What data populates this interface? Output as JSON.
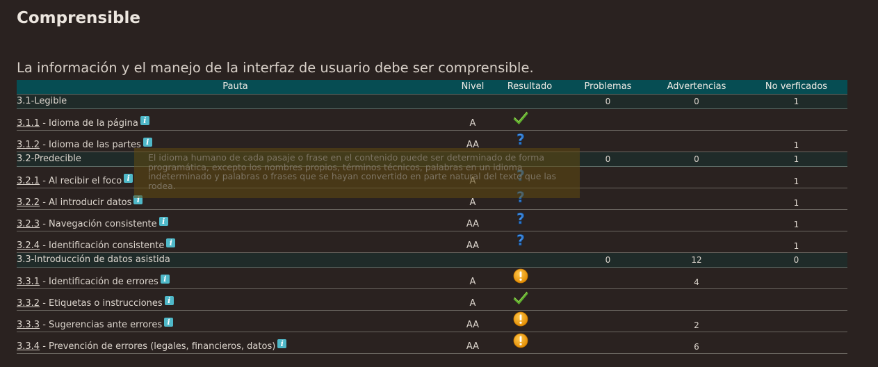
{
  "page": {
    "title": "Comprensible",
    "subtitle": "La información y el manejo de la interfaz de usuario debe ser comprensible."
  },
  "table": {
    "headers": [
      "Pauta",
      "Nivel",
      "Resultado",
      "Problemas",
      "Advertencias",
      "No verficados"
    ],
    "rows": [
      {
        "type": "group",
        "label": "3.1-Legible",
        "problemas": "0",
        "advertencias": "0",
        "no_verificados": "1"
      },
      {
        "type": "item",
        "code": "3.1.1",
        "label": " - Idioma de la página",
        "nivel": "A",
        "resultado": "check-icon",
        "advertencias": "",
        "no_verificados": ""
      },
      {
        "type": "item",
        "code": "3.1.2",
        "label": " - Idioma de las partes",
        "nivel": "AA",
        "resultado": "question-icon",
        "advertencias": "",
        "no_verificados": "1"
      },
      {
        "type": "group",
        "label": "3.2-Predecible",
        "problemas": "0",
        "advertencias": "0",
        "no_verificados": "1"
      },
      {
        "type": "item",
        "code": "3.2.1",
        "label": " - Al recibir el foco",
        "nivel": "A",
        "resultado": "question-icon",
        "advertencias": "",
        "no_verificados": "1"
      },
      {
        "type": "item",
        "code": "3.2.2",
        "label": " - Al introducir datos",
        "nivel": "A",
        "resultado": "question-icon",
        "advertencias": "",
        "no_verificados": "1"
      },
      {
        "type": "item",
        "code": "3.2.3",
        "label": " - Navegación consistente",
        "nivel": "AA",
        "resultado": "question-icon",
        "advertencias": "",
        "no_verificados": "1"
      },
      {
        "type": "item",
        "code": "3.2.4",
        "label": " - Identificación consistente",
        "nivel": "AA",
        "resultado": "question-icon",
        "advertencias": "",
        "no_verificados": "1"
      },
      {
        "type": "group",
        "label": "3.3-Introducción de datos asistida",
        "problemas": "0",
        "advertencias": "12",
        "no_verificados": "0"
      },
      {
        "type": "item",
        "code": "3.3.1",
        "label": " - Identificación de errores",
        "nivel": "A",
        "resultado": "warning-icon",
        "advertencias": "4",
        "no_verificados": ""
      },
      {
        "type": "item",
        "code": "3.3.2",
        "label": " - Etiquetas o instrucciones",
        "nivel": "A",
        "resultado": "check-icon",
        "advertencias": "",
        "no_verificados": ""
      },
      {
        "type": "item",
        "code": "3.3.3",
        "label": " - Sugerencias ante errores",
        "nivel": "AA",
        "resultado": "warning-icon",
        "advertencias": "2",
        "no_verificados": ""
      },
      {
        "type": "item",
        "code": "3.3.4",
        "label": " - Prevención de errores (legales, financieros, datos)",
        "nivel": "AA",
        "resultado": "warning-icon",
        "advertencias": "6",
        "no_verificados": ""
      }
    ]
  },
  "tooltip": {
    "text": "El idioma humano de cada pasaje o frase en el contenido puede ser determinado de forma programática, excepto los nombres propios, términos técnicos, palabras en un idioma indeterminado y palabras o frases que se hayan convertido en parte natural del texto que las rodea."
  },
  "colors": {
    "background": "#2a2220",
    "header_bg": "#064d53",
    "group_bg": "#1f2b29",
    "check": "#5fae2e",
    "question": "#1f73c8",
    "warning": "#f0a21a",
    "info": "#4fb8c8"
  }
}
